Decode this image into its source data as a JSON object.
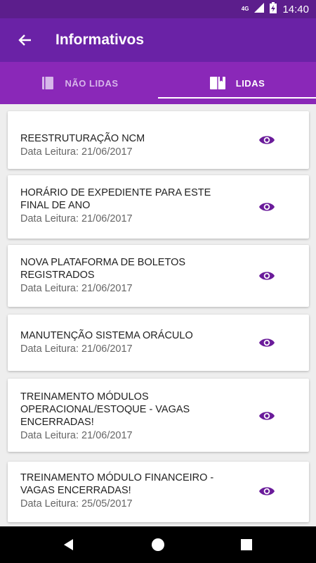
{
  "status_bar": {
    "network": "4G",
    "time": "14:40"
  },
  "app_bar": {
    "title": "Informativos"
  },
  "tabs": [
    {
      "label": "NÃO LIDAS",
      "icon": "book-icon",
      "active": false
    },
    {
      "label": "LIDAS",
      "icon": "open-book-icon",
      "active": true
    }
  ],
  "items": [
    {
      "title": "REESTRUTURAÇÃO NCM",
      "date": "Data Leitura: 21/06/2017",
      "action_icon": "eye-icon"
    },
    {
      "title": "HORÁRIO DE EXPEDIENTE PARA ESTE FINAL DE ANO",
      "date": "Data Leitura: 21/06/2017",
      "action_icon": "eye-icon"
    },
    {
      "title": "NOVA PLATAFORMA DE BOLETOS REGISTRADOS",
      "date": "Data Leitura: 21/06/2017",
      "action_icon": "eye-icon"
    },
    {
      "title": "MANUTENÇÃO SISTEMA ORÁCULO",
      "date": "Data Leitura: 21/06/2017",
      "action_icon": "eye-icon"
    },
    {
      "title": "TREINAMENTO MÓDULOS OPERACIONAL/ESTOQUE - VAGAS ENCERRADAS!",
      "date": "Data Leitura: 21/06/2017",
      "action_icon": "eye-icon"
    },
    {
      "title": "TREINAMENTO MÓDULO FINANCEIRO - VAGAS ENCERRADAS!",
      "date": "Data Leitura: 25/05/2017",
      "action_icon": "eye-icon"
    }
  ],
  "colors": {
    "status_bar": "#5c1e8c",
    "app_bar": "#6a22a6",
    "tab_bar": "#8a28b8",
    "accent": "#6a1b9a"
  }
}
